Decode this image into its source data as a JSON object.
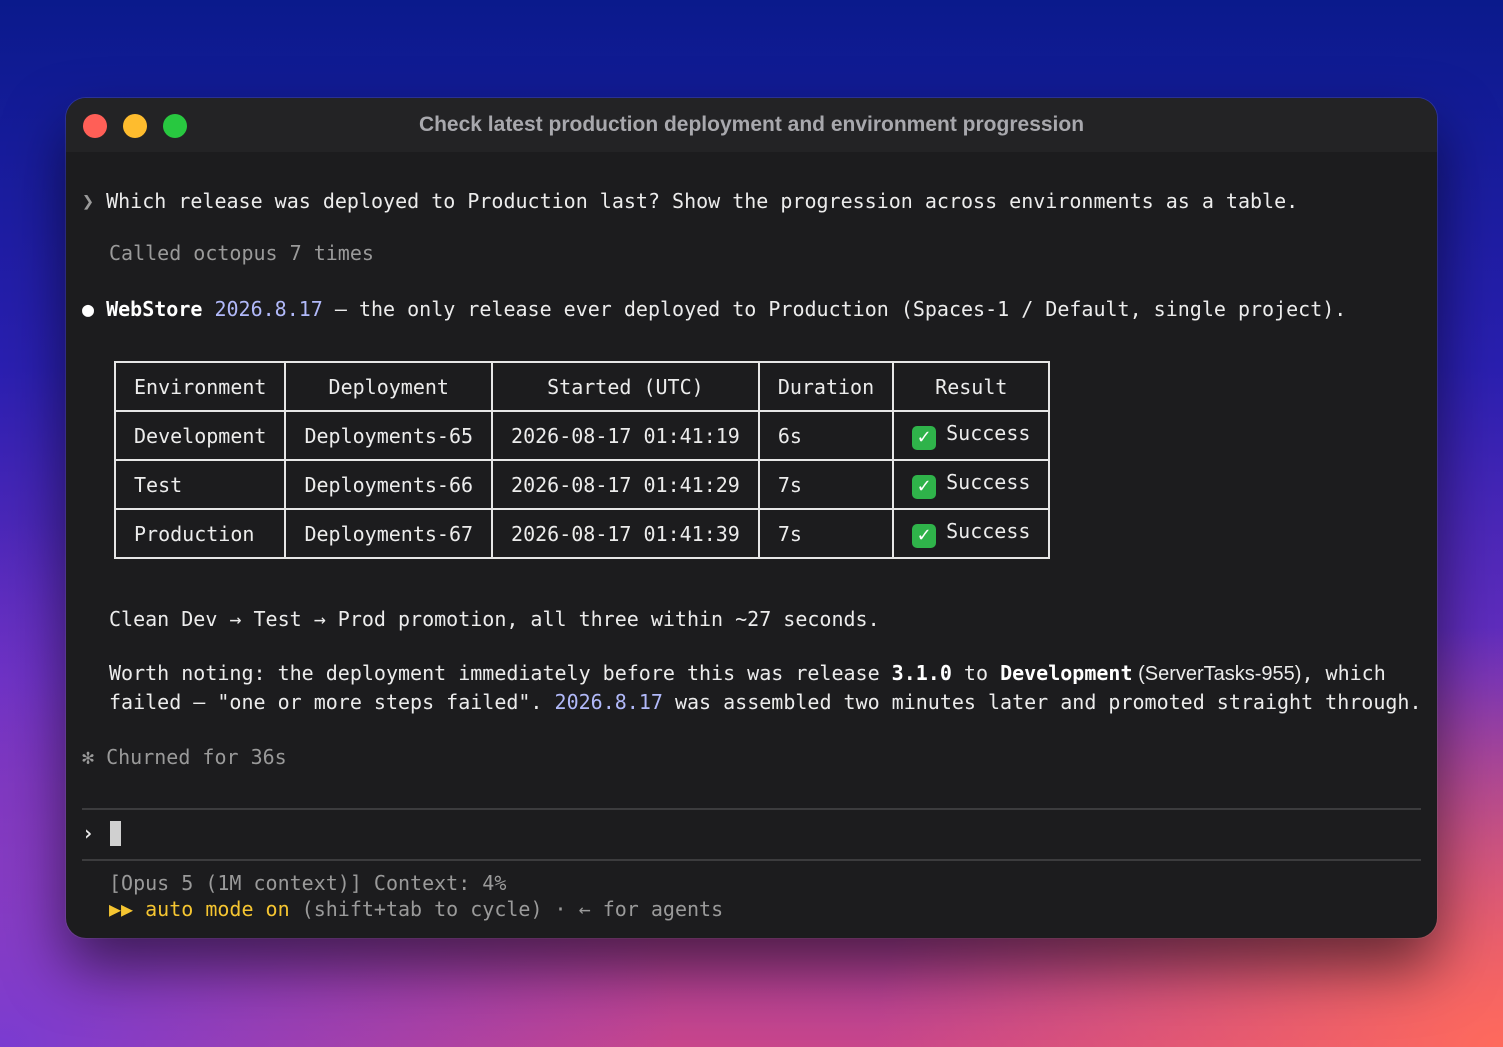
{
  "window": {
    "title": "Check latest production deployment and environment progression"
  },
  "prompt": {
    "marker": "❯",
    "text": "Which release was deployed to Production last? Show the progression across environments as a table."
  },
  "tool_call": "Called octopus 7 times",
  "answer": {
    "bullet": "●",
    "project": "WebStore",
    "release": "2026.8.17",
    "summary": " – the only release ever deployed to Production (Spaces-1 / Default, single project)."
  },
  "table": {
    "headers": [
      "Environment",
      "Deployment",
      "Started (UTC)",
      "Duration",
      "Result"
    ],
    "rows": [
      {
        "environment": "Development",
        "deployment": "Deployments-65",
        "started": "2026-08-17 01:41:19",
        "duration": "6s",
        "result": "Success",
        "result_icon": "check-icon"
      },
      {
        "environment": "Test",
        "deployment": "Deployments-66",
        "started": "2026-08-17 01:41:29",
        "duration": "7s",
        "result": "Success",
        "result_icon": "check-icon"
      },
      {
        "environment": "Production",
        "deployment": "Deployments-67",
        "started": "2026-08-17 01:41:39",
        "duration": "7s",
        "result": "Success",
        "result_icon": "check-icon"
      }
    ],
    "check_glyph": "✓"
  },
  "promotion_note": "Clean Dev → Test → Prod promotion, all three within ~27 seconds.",
  "worth_noting": {
    "line1_prefix": "Worth noting: the deployment immediately before this was release ",
    "release_prev": "3.1.0",
    "line1_mid": " to ",
    "env": "Development",
    "task": " (ServerTasks-955)",
    "line1_suffix": ", which",
    "line2_prefix": "failed – \"one or more steps failed\". ",
    "release": "2026.8.17",
    "line2_suffix": " was assembled two minutes later and promoted straight through."
  },
  "status": {
    "marker": "✻",
    "text": "Churned for 36s"
  },
  "input": {
    "marker": "›",
    "value": ""
  },
  "footer": {
    "model_line": "[Opus 5 (1M context)] Context: 4%",
    "mode_icon": "▶▶",
    "mode_label": "auto mode on",
    "mode_hint": " (shift+tab to cycle) · ← for agents"
  },
  "colors": {
    "accent": "#b1b9f9",
    "auto_mode": "#f5c531",
    "success": "#2fb34a",
    "window_bg": "#1c1c1e"
  }
}
